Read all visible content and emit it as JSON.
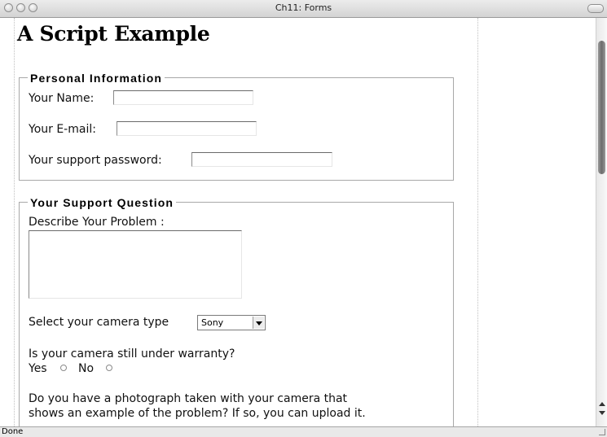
{
  "window": {
    "title": "Ch11: Forms"
  },
  "page": {
    "heading": "A Script Example"
  },
  "personal": {
    "legend": "Personal Information",
    "name_label": "Your Name:",
    "name_value": "",
    "email_label": "Your E-mail:",
    "email_value": "",
    "password_label": "Your support password:",
    "password_value": ""
  },
  "support": {
    "legend": "Your Support Question",
    "describe_label": "Describe Your Problem :",
    "describe_value": "",
    "camera_label": "Select your camera type",
    "camera_value": "Sony",
    "warranty_label": "Is your camera still under warranty?",
    "yes_label": "Yes",
    "no_label": "No",
    "photo_line1": "Do you have a photograph taken with your camera that",
    "photo_line2": "shows an example of the problem? If so, you can upload it."
  },
  "status": {
    "text": "Done"
  }
}
